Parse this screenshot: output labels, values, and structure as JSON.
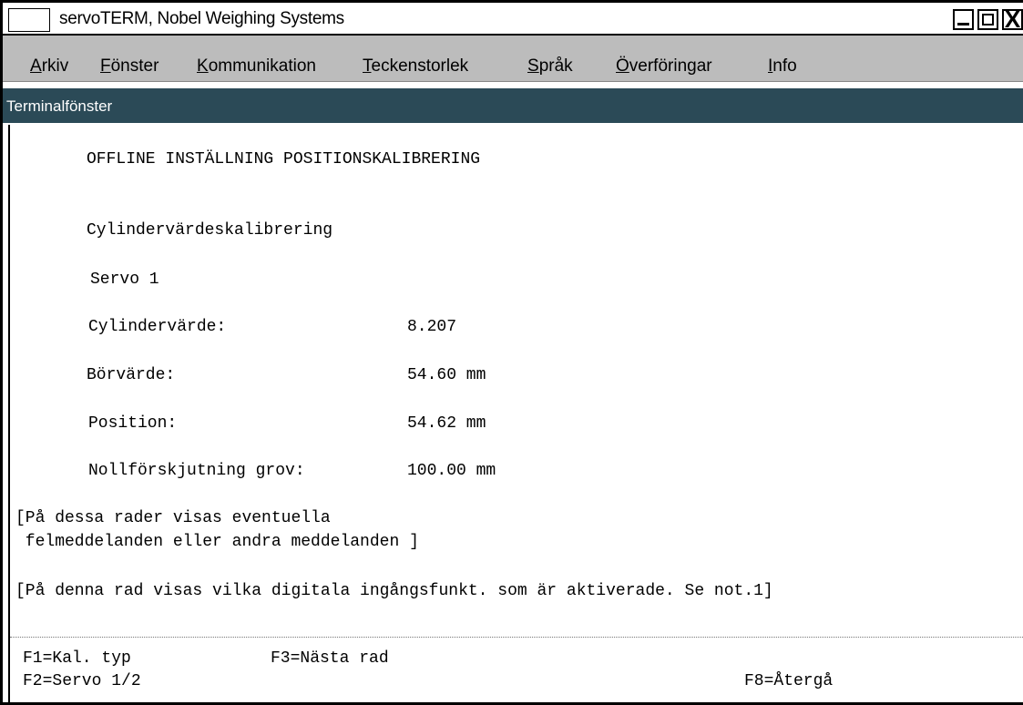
{
  "window": {
    "title": "servoTERM, Nobel Weighing Systems",
    "close_glyph": "X"
  },
  "menu": {
    "items": [
      {
        "mnemonic": "A",
        "rest": "rkiv"
      },
      {
        "mnemonic": "F",
        "rest": "önster"
      },
      {
        "mnemonic": "K",
        "rest": "ommunikation"
      },
      {
        "mnemonic": "T",
        "rest": "eckenstorlek"
      },
      {
        "mnemonic": "S",
        "rest": "pråk"
      },
      {
        "mnemonic": "Ö",
        "rest": "verföringar"
      },
      {
        "mnemonic": "I",
        "rest": "nfo"
      }
    ]
  },
  "panel": {
    "title": "Terminalfönster"
  },
  "terminal": {
    "heading": "OFFLINE INSTÄLLNING POSITIONSKALIBRERING",
    "section": "Cylindervärdeskalibrering",
    "servo": "Servo 1",
    "fields": [
      {
        "label": "Cylindervärde:",
        "value": "8.207"
      },
      {
        "label": "Börvärde:",
        "value": "54.60 mm"
      },
      {
        "label": "Position:",
        "value": "54.62 mm"
      },
      {
        "label": "Nollförskjutning grov:",
        "value": "100.00 mm"
      }
    ],
    "message_line1": "[På dessa rader visas eventuella",
    "message_line2": " felmeddelanden eller andra meddelanden ]",
    "digital_line": "[På denna rad visas vilka digitala ingångsfunkt. som är aktiverade. Se not.1]"
  },
  "function_keys": {
    "f1": "F1=Kal. typ",
    "f3": "F3=Nästa rad",
    "f2": "F2=Servo 1/2",
    "f8": "F8=Återgå"
  }
}
